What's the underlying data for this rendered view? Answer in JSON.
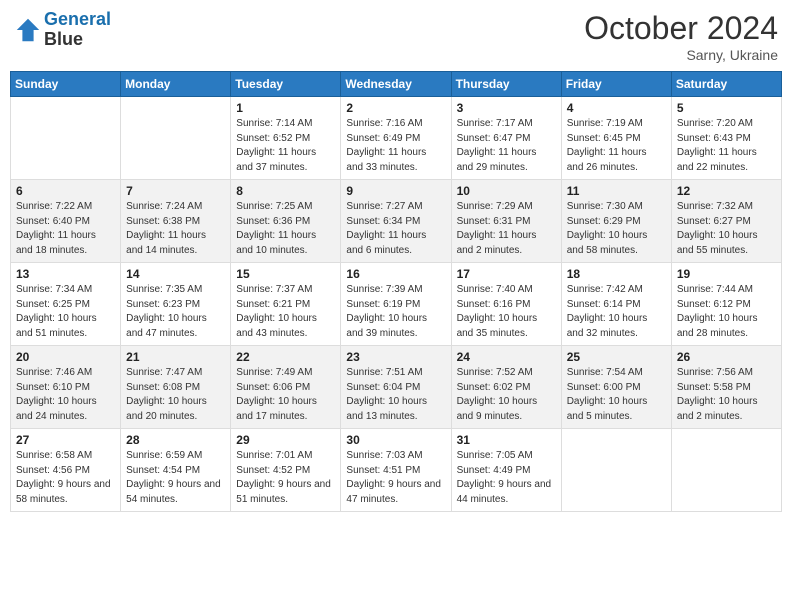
{
  "header": {
    "logo_line1": "General",
    "logo_line2": "Blue",
    "month": "October 2024",
    "location": "Sarny, Ukraine"
  },
  "weekdays": [
    "Sunday",
    "Monday",
    "Tuesday",
    "Wednesday",
    "Thursday",
    "Friday",
    "Saturday"
  ],
  "weeks": [
    [
      {
        "day": null,
        "info": null
      },
      {
        "day": null,
        "info": null
      },
      {
        "day": "1",
        "info": "Sunrise: 7:14 AM\nSunset: 6:52 PM\nDaylight: 11 hours\nand 37 minutes."
      },
      {
        "day": "2",
        "info": "Sunrise: 7:16 AM\nSunset: 6:49 PM\nDaylight: 11 hours\nand 33 minutes."
      },
      {
        "day": "3",
        "info": "Sunrise: 7:17 AM\nSunset: 6:47 PM\nDaylight: 11 hours\nand 29 minutes."
      },
      {
        "day": "4",
        "info": "Sunrise: 7:19 AM\nSunset: 6:45 PM\nDaylight: 11 hours\nand 26 minutes."
      },
      {
        "day": "5",
        "info": "Sunrise: 7:20 AM\nSunset: 6:43 PM\nDaylight: 11 hours\nand 22 minutes."
      }
    ],
    [
      {
        "day": "6",
        "info": "Sunrise: 7:22 AM\nSunset: 6:40 PM\nDaylight: 11 hours\nand 18 minutes."
      },
      {
        "day": "7",
        "info": "Sunrise: 7:24 AM\nSunset: 6:38 PM\nDaylight: 11 hours\nand 14 minutes."
      },
      {
        "day": "8",
        "info": "Sunrise: 7:25 AM\nSunset: 6:36 PM\nDaylight: 11 hours\nand 10 minutes."
      },
      {
        "day": "9",
        "info": "Sunrise: 7:27 AM\nSunset: 6:34 PM\nDaylight: 11 hours\nand 6 minutes."
      },
      {
        "day": "10",
        "info": "Sunrise: 7:29 AM\nSunset: 6:31 PM\nDaylight: 11 hours\nand 2 minutes."
      },
      {
        "day": "11",
        "info": "Sunrise: 7:30 AM\nSunset: 6:29 PM\nDaylight: 10 hours\nand 58 minutes."
      },
      {
        "day": "12",
        "info": "Sunrise: 7:32 AM\nSunset: 6:27 PM\nDaylight: 10 hours\nand 55 minutes."
      }
    ],
    [
      {
        "day": "13",
        "info": "Sunrise: 7:34 AM\nSunset: 6:25 PM\nDaylight: 10 hours\nand 51 minutes."
      },
      {
        "day": "14",
        "info": "Sunrise: 7:35 AM\nSunset: 6:23 PM\nDaylight: 10 hours\nand 47 minutes."
      },
      {
        "day": "15",
        "info": "Sunrise: 7:37 AM\nSunset: 6:21 PM\nDaylight: 10 hours\nand 43 minutes."
      },
      {
        "day": "16",
        "info": "Sunrise: 7:39 AM\nSunset: 6:19 PM\nDaylight: 10 hours\nand 39 minutes."
      },
      {
        "day": "17",
        "info": "Sunrise: 7:40 AM\nSunset: 6:16 PM\nDaylight: 10 hours\nand 35 minutes."
      },
      {
        "day": "18",
        "info": "Sunrise: 7:42 AM\nSunset: 6:14 PM\nDaylight: 10 hours\nand 32 minutes."
      },
      {
        "day": "19",
        "info": "Sunrise: 7:44 AM\nSunset: 6:12 PM\nDaylight: 10 hours\nand 28 minutes."
      }
    ],
    [
      {
        "day": "20",
        "info": "Sunrise: 7:46 AM\nSunset: 6:10 PM\nDaylight: 10 hours\nand 24 minutes."
      },
      {
        "day": "21",
        "info": "Sunrise: 7:47 AM\nSunset: 6:08 PM\nDaylight: 10 hours\nand 20 minutes."
      },
      {
        "day": "22",
        "info": "Sunrise: 7:49 AM\nSunset: 6:06 PM\nDaylight: 10 hours\nand 17 minutes."
      },
      {
        "day": "23",
        "info": "Sunrise: 7:51 AM\nSunset: 6:04 PM\nDaylight: 10 hours\nand 13 minutes."
      },
      {
        "day": "24",
        "info": "Sunrise: 7:52 AM\nSunset: 6:02 PM\nDaylight: 10 hours\nand 9 minutes."
      },
      {
        "day": "25",
        "info": "Sunrise: 7:54 AM\nSunset: 6:00 PM\nDaylight: 10 hours\nand 5 minutes."
      },
      {
        "day": "26",
        "info": "Sunrise: 7:56 AM\nSunset: 5:58 PM\nDaylight: 10 hours\nand 2 minutes."
      }
    ],
    [
      {
        "day": "27",
        "info": "Sunrise: 6:58 AM\nSunset: 4:56 PM\nDaylight: 9 hours\nand 58 minutes."
      },
      {
        "day": "28",
        "info": "Sunrise: 6:59 AM\nSunset: 4:54 PM\nDaylight: 9 hours\nand 54 minutes."
      },
      {
        "day": "29",
        "info": "Sunrise: 7:01 AM\nSunset: 4:52 PM\nDaylight: 9 hours\nand 51 minutes."
      },
      {
        "day": "30",
        "info": "Sunrise: 7:03 AM\nSunset: 4:51 PM\nDaylight: 9 hours\nand 47 minutes."
      },
      {
        "day": "31",
        "info": "Sunrise: 7:05 AM\nSunset: 4:49 PM\nDaylight: 9 hours\nand 44 minutes."
      },
      {
        "day": null,
        "info": null
      },
      {
        "day": null,
        "info": null
      }
    ]
  ]
}
